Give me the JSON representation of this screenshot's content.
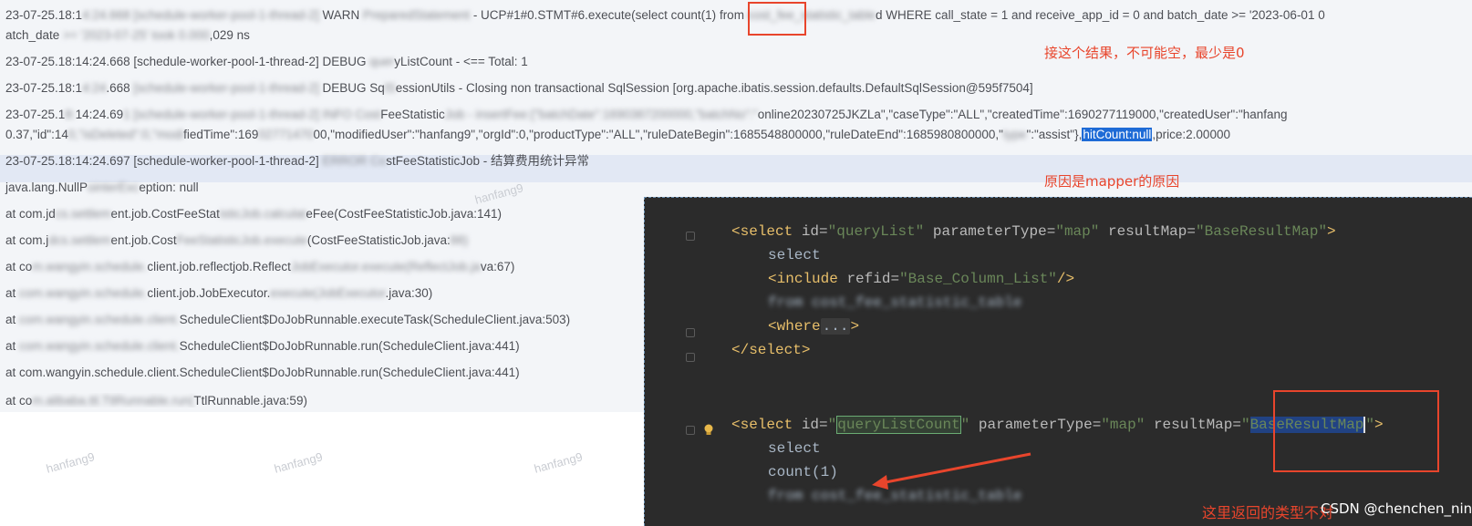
{
  "log": {
    "lines": [
      {
        "prefix": "23-07-25.18:1",
        "blur1": "4:24.668 [schedule-worker-pool-1-thread-2]",
        "mid": " WARN ",
        "blur2": "PreparedStatement",
        "text": " - UCP#1#0.STMT#6.execute(select ",
        "count": "count(1)",
        "after": " from ",
        "blur3": "cost_fee_statistic_table",
        "rest": "d WHERE call_state = 1 and receive_app_id = 0 and batch_date >= '2023-06-01 0"
      },
      {
        "prefix": "atch_date",
        "blur1": " >= '2023-07-25' took 0.000",
        "rest": ",029 ns"
      },
      {
        "text": "23-07-25.18:14:24.668 [schedule-worker-pool-1-thread-2] DEBUG ",
        "blur1": "quer",
        "rest": "yListCount - <== Total: 1"
      },
      {
        "text": "23-07-25.18:1",
        "blur1": "4:24",
        "mid": ".668 ",
        "blur2": "[schedule-worker-pool-1-thread-2]",
        "rest": " DEBUG Sq",
        "blur3": "lS",
        "rest2": "essionUtils - Closing non transactional SqlSession [org.apache.ibatis.session.defaults.DefaultSqlSession@595f7504]"
      },
      {
        "text": "23-07-25.1",
        "blur1": "8:",
        "mid": "14:24.69",
        "blur2": "1 [schedule-worker-pool-1-thread-2] INFO Cost",
        "rest": "FeeStatistic",
        "blur3": "Job - insertFee:{\"batchDate\":1690387200000,\"batchNo\":\"",
        "rest2": "online20230725JKZLa\",\"caseType\":\"ALL\",\"createdTime\":1690277119000,\"createdUser\":\"hanfang"
      },
      {
        "text": "0.37,\"id\":14",
        "blur1": "0,\"isDeleted\":0,\"modi",
        "mid": "fiedTime\":169",
        "blur2": "02771470",
        "rest": "00,\"modifiedUser\":\"hanfang9\",\"orgId\":0,\"productType\":\"ALL\",\"ruleDateBegin\":1685548800000,\"ruleDateEnd\":1685980800000,\"",
        "blur3": "type",
        "rest2": "\":\"assist\"},",
        "sel": "hitCount:null",
        "tail": ",price:2.00000"
      },
      {
        "text": "23-07-25.18:14:24.697 [schedule-worker-pool-1-thread-2] ",
        "blur1": "ERROR Co",
        "rest": "stFeeStatisticJob - 结算费用统计异常"
      },
      {
        "text": "java.lang.NullP",
        "blur1": "ointerExc",
        "rest": "eption: null"
      },
      {
        "text": "at com.jd",
        "blur1": "cs.settlem",
        "mid": "ent.job.CostFeeStat",
        "blur2": "isticJob.calculat",
        "rest": "eFee(CostFeeStatisticJob.java:141)"
      },
      {
        "text": "at com.j",
        "blur1": "dcs.settlem",
        "mid": "ent.job.Cost",
        "blur2": "FeeStatisticJob.execute",
        "rest": "(CostFeeStatisticJob.java:",
        "blur3": "88)"
      },
      {
        "text": "at co",
        "blur1": "m.wangyin.schedule.",
        "rest": "client.job.reflectjob.Reflect",
        "blur2": "JobExecutor.execute(ReflectJob.ja",
        "rest2": "va:67)"
      },
      {
        "text": "at",
        "blur1": " com.wangyin.schedule.",
        "rest": "client.job.JobExecutor.",
        "blur2": "execute(JobExecutor",
        "rest2": ".java:30)"
      },
      {
        "text": "at ",
        "blur1": "com.wangyin.schedule.client.",
        "rest": "ScheduleClient$DoJobRunnable.executeTask(ScheduleClient.java:503)"
      },
      {
        "text": "at ",
        "blur1": "com.wangyin.schedule.client.",
        "rest": "ScheduleClient$DoJobRunnable.run(ScheduleClient.java:441)"
      },
      {
        "text": "at com.wangyin.schedule.client.ScheduleClient$DoJobRunnable.run(ScheduleClient.java:441)"
      },
      {
        "text": "at co",
        "blur1": "m.alibaba.ttl.TtlRunnable.run(",
        "rest": "TtlRunnable.java:59)"
      }
    ]
  },
  "annotations": {
    "top_note": "接这个结果，不可能空，最少是0",
    "cause_note": "原因是mapper的原因",
    "bottom_note": "这里返回的类型不对",
    "credit": "CSDN @chenchen_nini"
  },
  "watermark": "hanfang9",
  "code": {
    "block1_open": {
      "tag": "select",
      "attrs": [
        [
          "id",
          "queryList"
        ],
        [
          "parameterType",
          "map"
        ],
        [
          "resultMap",
          "BaseResultMap"
        ]
      ]
    },
    "select_kw": "select",
    "include": {
      "tag": "include",
      "attr": "refid",
      "value": "Base_Column_List"
    },
    "from_blur": "from cost_fee_statistic_table",
    "where_fold": "where",
    "ellipsis": "...",
    "close_select": "select",
    "block2_open": {
      "tag": "select",
      "id": "queryListCount",
      "parameterType": "map",
      "resultMap": "BaseResultMap"
    },
    "count_expr": "count(1)"
  },
  "colors": {
    "annotation": "#e8452c",
    "selection": "#1e6bd6",
    "editor_bg": "#2b2b2b"
  }
}
